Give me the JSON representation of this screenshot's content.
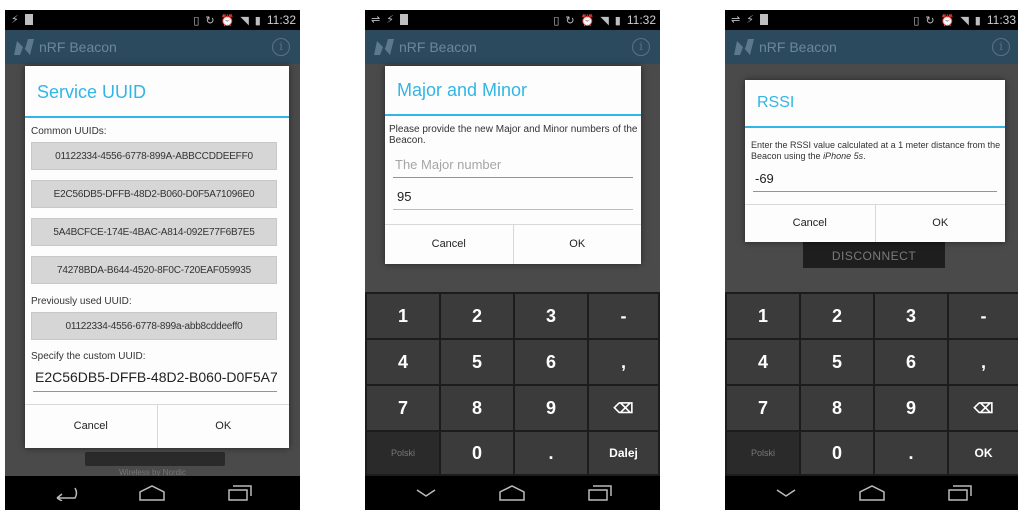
{
  "status_bar": {
    "time": "11:32",
    "time3": "11:33"
  },
  "app": {
    "title": "nRF Beacon",
    "info_icon": "info-icon"
  },
  "screen1": {
    "dialog_title": "Service UUID",
    "common_label": "Common UUIDs:",
    "common_uuids": [
      "01122334-4556-6778-899A-ABBCCDDEEFF0",
      "E2C56DB5-DFFB-48D2-B060-D0F5A71096E0",
      "5A4BCFCE-174E-4BAC-A814-092E77F6B7E5",
      "74278BDA-B644-4520-8F0C-720EAF059935"
    ],
    "previous_label": "Previously used UUID:",
    "previous_uuid": "01122334-4556-6778-899a-abb8cddeeff0",
    "custom_label": "Specify the custom UUID:",
    "custom_value": "E2C56DB5-DFFB-48D2-B060-D0F5A7",
    "cancel": "Cancel",
    "ok": "OK",
    "footer_text": "Wireless by Nordic"
  },
  "screen2": {
    "dialog_title": "Major and Minor",
    "prompt": "Please provide the new Major and Minor numbers of the Beacon.",
    "major_placeholder": "The Major number",
    "minor_value": "95",
    "cancel": "Cancel",
    "ok": "OK",
    "keys": [
      "1",
      "2",
      "3",
      "-",
      "4",
      "5",
      "6",
      ",",
      "7",
      "8",
      "9",
      "⌫",
      "Polski",
      "0",
      ".",
      "Dalej"
    ]
  },
  "screen3": {
    "dialog_title": "RSSI",
    "prompt_a": "Enter the RSSI value calculated at a 1 meter distance from the Beacon using the ",
    "prompt_b": "iPhone 5s",
    "prompt_c": ".",
    "rssi_value": "-69",
    "cancel": "Cancel",
    "ok": "OK",
    "behind_button": "DISCONNECT",
    "keys": [
      "1",
      "2",
      "3",
      "-",
      "4",
      "5",
      "6",
      ",",
      "7",
      "8",
      "9",
      "⌫",
      "Polski",
      "0",
      ".",
      "OK"
    ]
  },
  "colors": {
    "accent": "#33b5e5",
    "action_bar": "#2c4a5e"
  }
}
